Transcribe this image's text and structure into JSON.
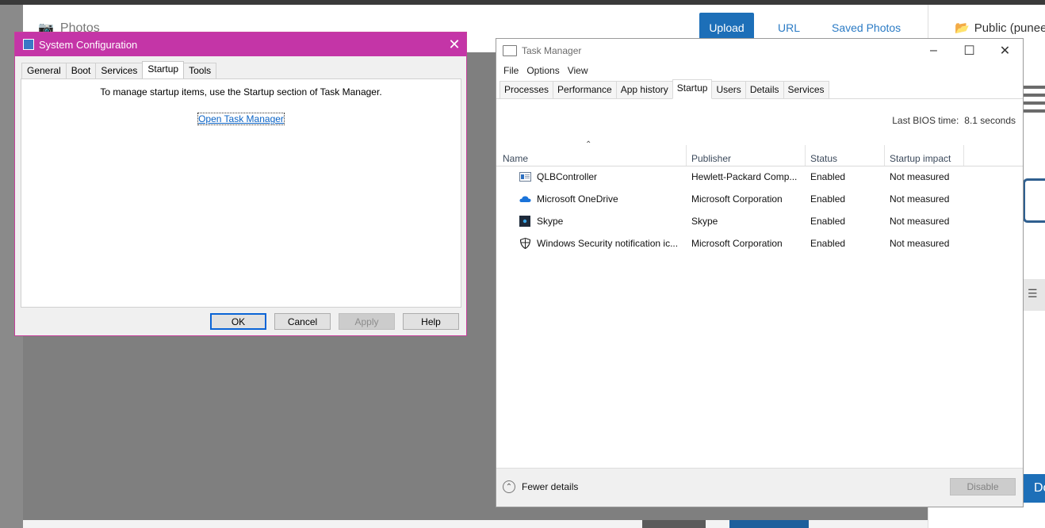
{
  "background": {
    "photos_title": "Photos",
    "upload_label": "Upload",
    "url_label": "URL",
    "saved_photos_label": "Saved Photos",
    "public_label": "Public (puneet",
    "right_button_label": "Do"
  },
  "system_config": {
    "title": "System Configuration",
    "tabs": [
      "General",
      "Boot",
      "Services",
      "Startup",
      "Tools"
    ],
    "active_tab": "Startup",
    "message": "To manage startup items, use the Startup section of Task Manager.",
    "link": "Open Task Manager",
    "buttons": {
      "ok": "OK",
      "cancel": "Cancel",
      "apply": "Apply",
      "help": "Help"
    },
    "accent_color": "#c435a7"
  },
  "task_manager": {
    "title": "Task Manager",
    "menu": [
      "File",
      "Options",
      "View"
    ],
    "tabs": [
      "Processes",
      "Performance",
      "App history",
      "Startup",
      "Users",
      "Details",
      "Services"
    ],
    "active_tab": "Startup",
    "bios_label": "Last BIOS time:",
    "bios_value": "8.1 seconds",
    "columns": [
      "Name",
      "Publisher",
      "Status",
      "Startup impact"
    ],
    "rows": [
      {
        "icon": "app-window-icon",
        "name": "QLBController",
        "publisher": "Hewlett-Packard Comp...",
        "status": "Enabled",
        "impact": "Not measured"
      },
      {
        "icon": "onedrive-cloud-icon",
        "name": "Microsoft OneDrive",
        "publisher": "Microsoft Corporation",
        "status": "Enabled",
        "impact": "Not measured"
      },
      {
        "icon": "skype-icon",
        "name": "Skype",
        "publisher": "Skype",
        "status": "Enabled",
        "impact": "Not measured"
      },
      {
        "icon": "shield-icon",
        "name": "Windows Security notification ic...",
        "publisher": "Microsoft Corporation",
        "status": "Enabled",
        "impact": "Not measured"
      }
    ],
    "fewer_details": "Fewer details",
    "disable": "Disable"
  }
}
